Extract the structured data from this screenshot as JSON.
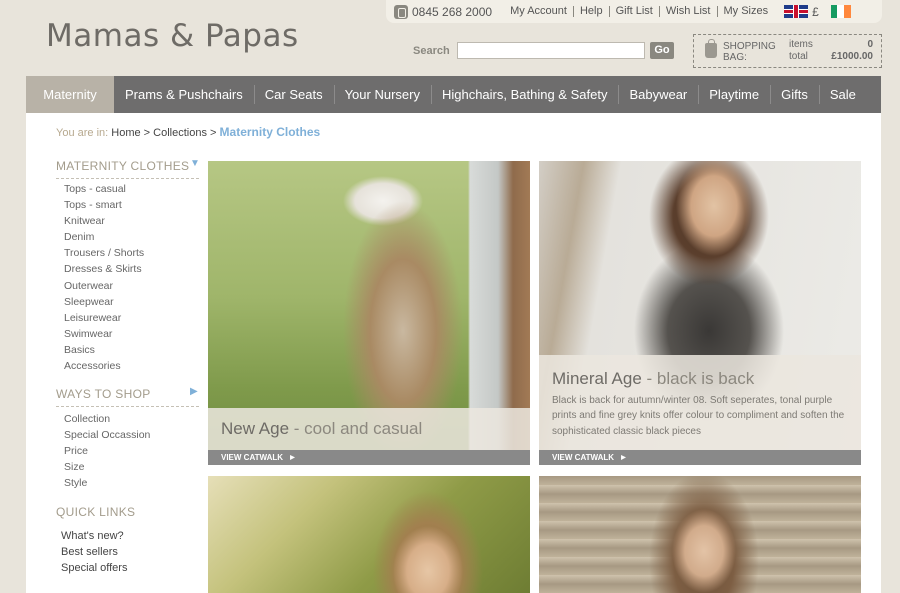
{
  "brand": {
    "logo_text": "Mamas & Papas"
  },
  "utility": {
    "phone": "0845 268 2000",
    "links": [
      "My Account",
      "Help",
      "Gift List",
      "Wish List",
      "My Sizes"
    ],
    "currency_symbol": "£",
    "flag_uk_icon": "uk-flag-icon",
    "flag_ie_icon": "ireland-flag-icon"
  },
  "search": {
    "label": "Search",
    "placeholder": "",
    "value": "",
    "button": "Go"
  },
  "bag": {
    "label_line1": "SHOPPING",
    "label_line2": "BAG:",
    "items_label": "items",
    "total_label": "total",
    "items_value": "0",
    "total_value": "£1000.00"
  },
  "nav": {
    "items": [
      "Maternity",
      "Prams & Pushchairs",
      "Car Seats",
      "Your Nursery",
      "Highchairs, Bathing & Safety",
      "Babywear",
      "Playtime",
      "Gifts",
      "Sale"
    ],
    "active_index": 0
  },
  "breadcrumb": {
    "label": "You are in:",
    "home": "Home",
    "collections": "Collections",
    "current": "Maternity Clothes",
    "separator": ">"
  },
  "sidebar": {
    "maternity": {
      "title": "MATERNITY CLOTHES",
      "items": [
        "Tops - casual",
        "Tops - smart",
        "Knitwear",
        "Denim",
        "Trousers / Shorts",
        "Dresses & Skirts",
        "Outerwear",
        "Sleepwear",
        "Leisurewear",
        "Swimwear",
        "Basics",
        "Accessories"
      ]
    },
    "ways": {
      "title": "WAYS TO SHOP",
      "items": [
        "Collection",
        "Special Occassion",
        "Price",
        "Size",
        "Style"
      ]
    },
    "quick": {
      "title": "QUICK LINKS",
      "items": [
        "What's new?",
        "Best sellers",
        "Special offers"
      ]
    }
  },
  "cards": [
    {
      "title": "New Age",
      "subtitle": "cool and casual",
      "dash": " - ",
      "desc": "",
      "cta": "VIEW CATWALK"
    },
    {
      "title": "Mineral Age",
      "subtitle": "black is back",
      "dash": " - ",
      "desc": "Black is back for autumn/winter 08. Soft seperates, tonal purple prints and fine grey knits offer colour to compliment and soften the sophisticated classic black pieces",
      "cta": "VIEW CATWALK"
    }
  ],
  "colors": {
    "page_bg": "#e8e4db",
    "nav_bg": "#6e6d6d",
    "nav_active": "#b8b2a7",
    "link_blue": "#7fb0d8"
  }
}
